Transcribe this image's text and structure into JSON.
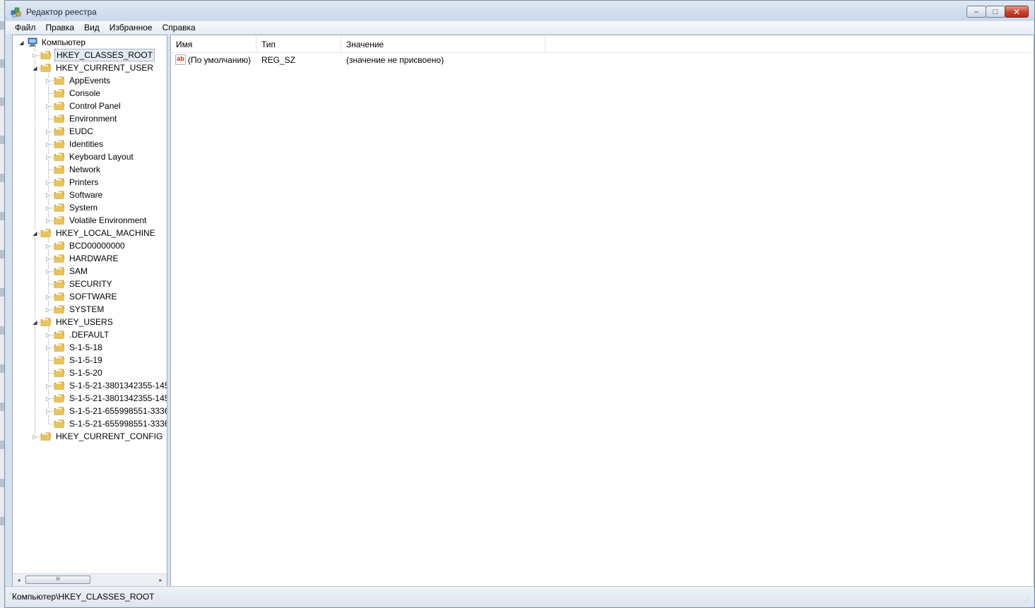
{
  "window": {
    "title": "Редактор реестра",
    "buttons": {
      "minimize": "–",
      "maximize": "□",
      "close": "✕"
    }
  },
  "menu": [
    "Файл",
    "Правка",
    "Вид",
    "Избранное",
    "Справка"
  ],
  "tree": {
    "root": "Компьютер",
    "selected": "HKEY_CLASSES_ROOT",
    "rows": [
      {
        "label": "HKEY_CLASSES_ROOT",
        "level": 1,
        "expander": "closed"
      },
      {
        "label": "HKEY_CURRENT_USER",
        "level": 1,
        "expander": "open"
      },
      {
        "label": "AppEvents",
        "level": 2,
        "expander": "closed"
      },
      {
        "label": "Console",
        "level": 2,
        "expander": "none"
      },
      {
        "label": "Control Panel",
        "level": 2,
        "expander": "closed"
      },
      {
        "label": "Environment",
        "level": 2,
        "expander": "none"
      },
      {
        "label": "EUDC",
        "level": 2,
        "expander": "closed"
      },
      {
        "label": "Identities",
        "level": 2,
        "expander": "closed"
      },
      {
        "label": "Keyboard Layout",
        "level": 2,
        "expander": "closed"
      },
      {
        "label": "Network",
        "level": 2,
        "expander": "none"
      },
      {
        "label": "Printers",
        "level": 2,
        "expander": "closed"
      },
      {
        "label": "Software",
        "level": 2,
        "expander": "closed"
      },
      {
        "label": "System",
        "level": 2,
        "expander": "closed"
      },
      {
        "label": "Volatile Environment",
        "level": 2,
        "expander": "closed"
      },
      {
        "label": "HKEY_LOCAL_MACHINE",
        "level": 1,
        "expander": "open"
      },
      {
        "label": "BCD00000000",
        "level": 2,
        "expander": "closed"
      },
      {
        "label": "HARDWARE",
        "level": 2,
        "expander": "closed"
      },
      {
        "label": "SAM",
        "level": 2,
        "expander": "closed"
      },
      {
        "label": "SECURITY",
        "level": 2,
        "expander": "none"
      },
      {
        "label": "SOFTWARE",
        "level": 2,
        "expander": "closed"
      },
      {
        "label": "SYSTEM",
        "level": 2,
        "expander": "closed"
      },
      {
        "label": "HKEY_USERS",
        "level": 1,
        "expander": "open"
      },
      {
        "label": ".DEFAULT",
        "level": 2,
        "expander": "closed"
      },
      {
        "label": "S-1-5-18",
        "level": 2,
        "expander": "closed"
      },
      {
        "label": "S-1-5-19",
        "level": 2,
        "expander": "none"
      },
      {
        "label": "S-1-5-20",
        "level": 2,
        "expander": "none"
      },
      {
        "label": "S-1-5-21-3801342355-145",
        "level": 2,
        "expander": "closed"
      },
      {
        "label": "S-1-5-21-3801342355-145",
        "level": 2,
        "expander": "closed"
      },
      {
        "label": "S-1-5-21-655998551-3336",
        "level": 2,
        "expander": "closed"
      },
      {
        "label": "S-1-5-21-655998551-3336",
        "level": 2,
        "expander": "none"
      },
      {
        "label": "HKEY_CURRENT_CONFIG",
        "level": 1,
        "expander": "closed"
      }
    ],
    "scroll": {
      "left": "◂",
      "right": "▸",
      "grip": "III"
    }
  },
  "list": {
    "columns": [
      "Имя",
      "Тип",
      "Значение"
    ],
    "rows": [
      {
        "icon": "ab",
        "name": "(По умолчанию)",
        "type": "REG_SZ",
        "value": "(значение не присвоено)"
      }
    ]
  },
  "status": {
    "path": "Компьютер\\HKEY_CLASSES_ROOT"
  },
  "colors": {
    "folder": "#e8c45a",
    "folder_dark": "#c99a2a",
    "selection": "#e4ebf4",
    "close_button": "#c8412a"
  }
}
